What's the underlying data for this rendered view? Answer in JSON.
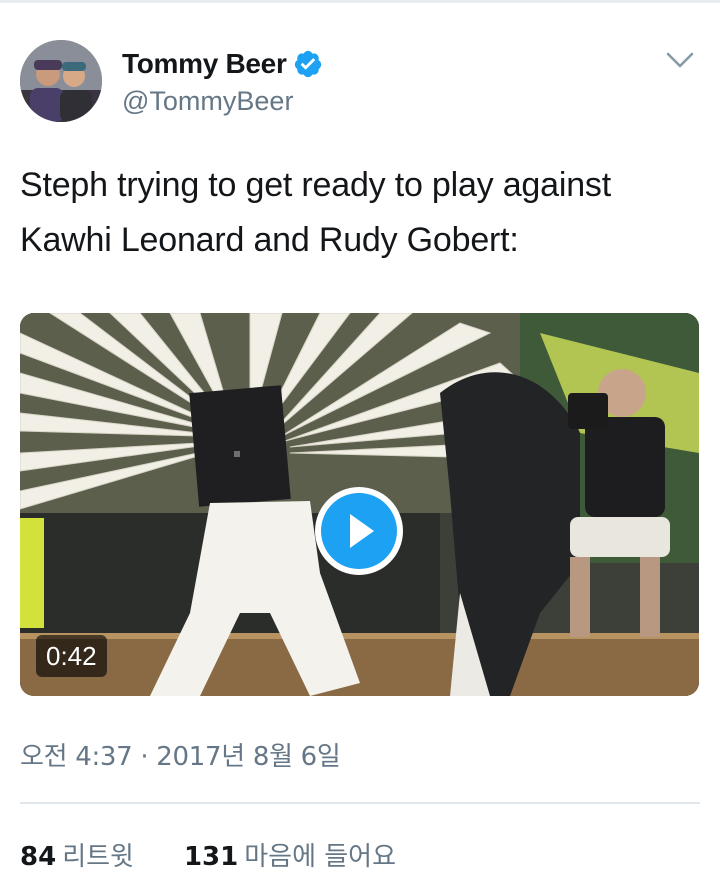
{
  "author": {
    "display_name": "Tommy Beer",
    "handle": "@TommyBeer",
    "verified": true
  },
  "tweet": {
    "text_line1": "Steph trying to get ready to play against",
    "text_line2": "Kawhi Leonard and Rudy Gobert:"
  },
  "media": {
    "type": "video",
    "duration": "0:42"
  },
  "timestamp": "오전 4:37 · 2017년 8월 6일",
  "stats": {
    "retweets_count": "84",
    "retweets_label": "리트윗",
    "likes_count": "131",
    "likes_label": "마음에 들어요"
  },
  "colors": {
    "accent": "#1da1f2",
    "secondary_text": "#657786"
  },
  "icons": {
    "verified": "verified-badge-icon",
    "menu": "chevron-down-icon",
    "play": "play-icon"
  }
}
